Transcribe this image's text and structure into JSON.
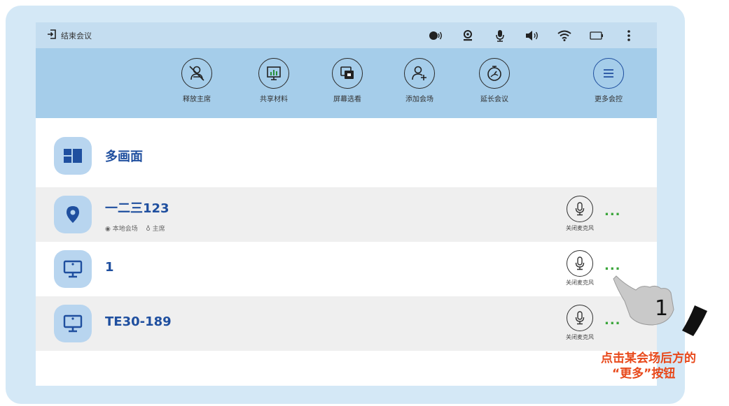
{
  "statusbar": {
    "exit_label": "结束会议",
    "icons": [
      "speaker-talk-icon",
      "camera-icon",
      "microphone-icon",
      "volume-icon",
      "wifi-icon",
      "battery-icon",
      "more-vertical-icon"
    ]
  },
  "toolbar": {
    "items": [
      {
        "label": "释放主席",
        "icon": "release-chair-icon"
      },
      {
        "label": "共享材料",
        "icon": "share-material-icon"
      },
      {
        "label": "屏幕选看",
        "icon": "screen-select-icon"
      },
      {
        "label": "添加会场",
        "icon": "add-site-icon"
      },
      {
        "label": "延长会议",
        "icon": "extend-meeting-icon"
      },
      {
        "label": "更多会控",
        "icon": "more-control-icon"
      }
    ]
  },
  "list": {
    "multi_screen": {
      "title": "多画面"
    },
    "rows": [
      {
        "title": "一二三123",
        "tag_local": "本地会场",
        "tag_chair": "主席",
        "mic_label": "关闭麦克风"
      },
      {
        "title": "1",
        "mic_label": "关闭麦克风"
      },
      {
        "title": "TE30-189",
        "mic_label": "关闭麦克风"
      }
    ],
    "more_label": "..."
  },
  "annotation": {
    "step_number": "1",
    "line1": "点击某会场后方的",
    "line2": "“更多”按钮",
    "text_color": "#e8481a"
  },
  "colors": {
    "accent": "#1f4f9f",
    "toolbar_bg": "#a5cdea",
    "statusbar_bg": "#c4ddf0",
    "more_dots": "#3aa53a"
  }
}
